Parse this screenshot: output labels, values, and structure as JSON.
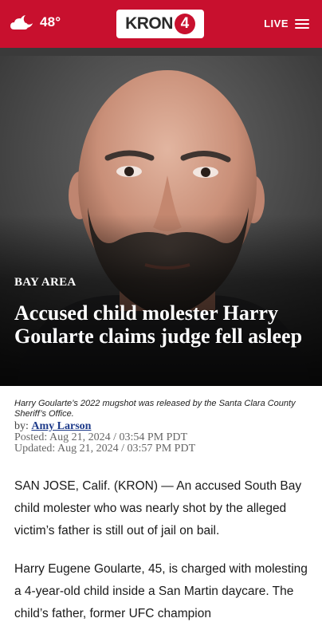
{
  "header": {
    "weather_icon": "cloudy-night-icon",
    "temperature": "48°",
    "logo_text": "KRON",
    "logo_number": "4",
    "live_label": "LIVE",
    "menu_icon": "hamburger-menu-icon",
    "brand_color": "#c8102e"
  },
  "article": {
    "category": "BAY AREA",
    "headline": "Accused child molester Harry Goularte claims judge fell asleep",
    "caption": "Harry Goularte’s 2022 mugshot was released by the Santa Clara County Sheriff’s Office.",
    "byline_prefix": "by:",
    "author": "Amy Larson",
    "posted": "Posted: Aug 21, 2024 / 03:54 PM PDT",
    "updated": "Updated: Aug 21, 2024 / 03:57 PM PDT",
    "paragraphs": [
      "SAN JOSE, Calif. (KRON) — An accused South Bay child molester who was nearly shot by the alleged victim’s father is still out of jail on bail.",
      "Harry Eugene Goularte, 45, is charged with molesting a 4-year-old child inside a San Martin daycare. The child’s father, former UFC champion"
    ]
  }
}
